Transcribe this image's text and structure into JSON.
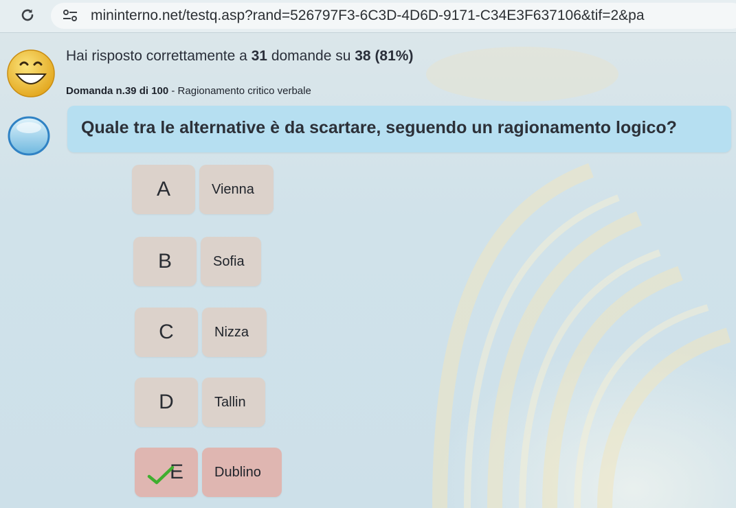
{
  "browser": {
    "url": "mininterno.net/testq.asp?rand=526797F3-6C3D-4D6D-9171-C34E3F637106&tif=2&pa"
  },
  "score": {
    "prefix": "Hai risposto correttamente a ",
    "correct": "31",
    "middle": " domande su ",
    "total": "38",
    "percent": " (81%)"
  },
  "question_meta": {
    "label": "Domanda n.39 di 100",
    "category": " - Ragionamento critico verbale"
  },
  "question": {
    "text": "Quale tra le alternative è da scartare, seguendo un ragionamento logico?"
  },
  "options": [
    {
      "letter": "A",
      "answer": "Vienna"
    },
    {
      "letter": "B",
      "answer": "Sofia"
    },
    {
      "letter": "C",
      "answer": "Nizza"
    },
    {
      "letter": "D",
      "answer": "Tallin"
    },
    {
      "letter": "E",
      "answer": "Dublino",
      "correct": true
    }
  ],
  "icons": {
    "reload": "reload-icon",
    "site_settings": "tune-icon",
    "result": "smiley-icon",
    "question": "speech-bubble-icon",
    "correct_mark": "check-icon"
  },
  "colors": {
    "question_box": "#b6dff1",
    "option_bg": "#dcd2cb",
    "correct_bg": "#dfb6b1",
    "check": "#3fae2f"
  }
}
